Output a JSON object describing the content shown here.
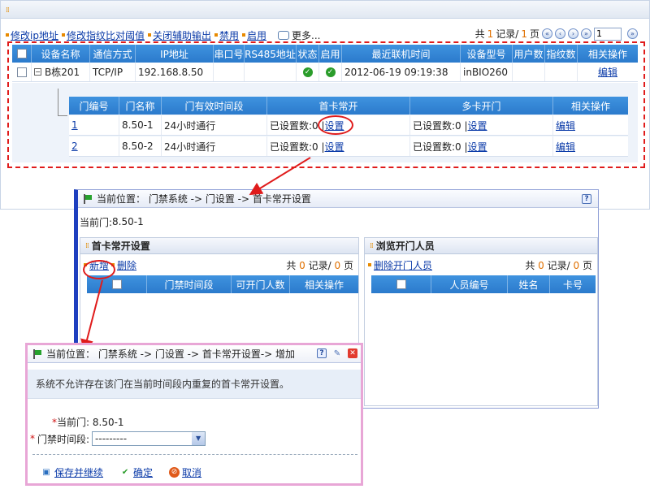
{
  "top": {
    "actions": [
      "修改ip地址",
      "修改指纹比对阈值",
      "关闭辅助输出",
      "禁用",
      "启用"
    ],
    "more": "更多...",
    "pager": {
      "prefix": "共",
      "records": "1",
      "records_label": "记录/",
      "pages": "1",
      "pages_label": "页",
      "page_input": "1"
    },
    "columns": [
      "设备名称",
      "通信方式",
      "IP地址",
      "串口号",
      "RS485地址",
      "状态",
      "启用",
      "最近联机时间",
      "设备型号",
      "用户数",
      "指纹数",
      "相关操作"
    ],
    "row": {
      "name": "B栋201",
      "comm": "TCP/IP",
      "ip": "192.168.8.50",
      "serial": "",
      "rs485": "",
      "last_online": "2012-06-19 09:19:38",
      "model": "inBIO260",
      "users": "",
      "fingerprints": "",
      "action": "编辑"
    },
    "door_columns": [
      "门编号",
      "门名称",
      "门有效时间段",
      "首卡常开",
      "多卡开门",
      "相关操作"
    ],
    "doors": [
      {
        "no": "1",
        "name": "8.50-1",
        "period": "24小时通行",
        "first_card": "已设置数:0 | ",
        "first_link": "设置",
        "multi_card": "已设置数:0 | ",
        "multi_link": "设置",
        "action": "编辑"
      },
      {
        "no": "2",
        "name": "8.50-2",
        "period": "24小时通行",
        "first_card": "已设置数:0 | ",
        "first_link": "设置",
        "multi_card": "已设置数:0 | ",
        "multi_link": "设置",
        "action": "编辑"
      }
    ]
  },
  "mid": {
    "breadcrumb": "当前位置： 门禁系统 -> 门设置 -> 首卡常开设置",
    "current_door_label": "当前门:",
    "current_door": "8.50-1",
    "left": {
      "title": "首卡常开设置",
      "add": "新增",
      "delete": "删除",
      "pager": {
        "prefix": "共",
        "records": "0",
        "records_label": "记录/",
        "pages": "0",
        "pages_label": "页"
      },
      "columns": [
        "门禁时间段",
        "可开门人数",
        "相关操作"
      ]
    },
    "right": {
      "title": "浏览开门人员",
      "delete": "删除开门人员",
      "pager": {
        "prefix": "共",
        "records": "0",
        "records_label": "记录/",
        "pages": "0",
        "pages_label": "页"
      },
      "columns": [
        "人员编号",
        "姓名",
        "卡号"
      ]
    }
  },
  "dialog": {
    "breadcrumb": "当前位置： 门禁系统 -> 门设置 -> 首卡常开设置-> 增加",
    "notice": "系统不允许存在该门在当前时间段内重复的首卡常开设置。",
    "current_door_label": "当前门:",
    "current_door": "8.50-1",
    "period_label": "门禁时间段:",
    "period_value": "---------",
    "save_continue": "保存并继续",
    "ok": "确定",
    "cancel": "取消"
  },
  "colors": {
    "accent": "#2b7acc",
    "highlight": "#e01b1b",
    "orange": "#e07000"
  }
}
